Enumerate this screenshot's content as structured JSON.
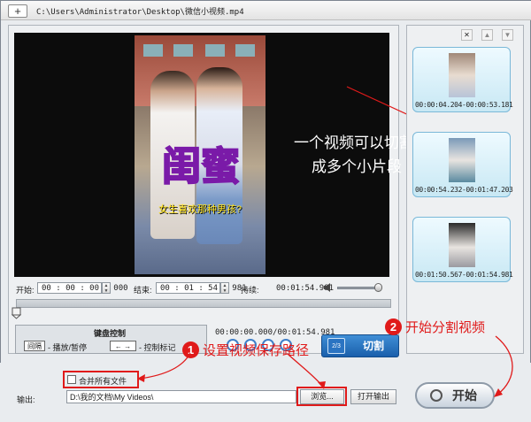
{
  "window": {
    "add_label": "+",
    "path": "C:\\Users\\Administrator\\Desktop\\微信小视频.mp4"
  },
  "video": {
    "overlay_title": "闺蜜",
    "overlay_subtitle": "女生喜欢那种男孩?"
  },
  "controls": {
    "start_label": "开始:",
    "start_value": "00 : 00 : 00 . 000",
    "end_label": "结束:",
    "end_value": "00 : 01 : 54 . 981",
    "duration_label": "持续:",
    "duration_value": "00:01:54.981",
    "position_readout": "00:00:00.000/00:01:54.981"
  },
  "keyboard": {
    "title": "键盘控制",
    "key1": "间隔",
    "key1_desc": "- 播放/暂停",
    "key2": "← →",
    "key2_desc": "- 控制标记"
  },
  "cut": {
    "label": "切割",
    "icon_text": "2/3"
  },
  "clips": [
    {
      "time": "00:00:04.204-00:00:53.181"
    },
    {
      "time": "00:00:54.232-00:01:47.203"
    },
    {
      "time": "00:01:50.567-00:01:54.981"
    }
  ],
  "output": {
    "merge_label": "合并所有文件",
    "output_label": "输出:",
    "path": "D:\\我的文档\\My Videos\\",
    "browse_label": "浏览...",
    "open_label": "打开输出",
    "start_label": "开始"
  },
  "annotations": {
    "note_line1": "一个视频可以切割",
    "note_line2": "成多个小片段",
    "step1_num": "1",
    "step1_text": "设置视频保存路径",
    "step2_num": "2",
    "step2_text": "开始分割视频"
  },
  "colors": {
    "annotation_red": "#e01a1a",
    "cut_button_blue": "#1a5fab",
    "clip_border": "#7ab8d8"
  }
}
